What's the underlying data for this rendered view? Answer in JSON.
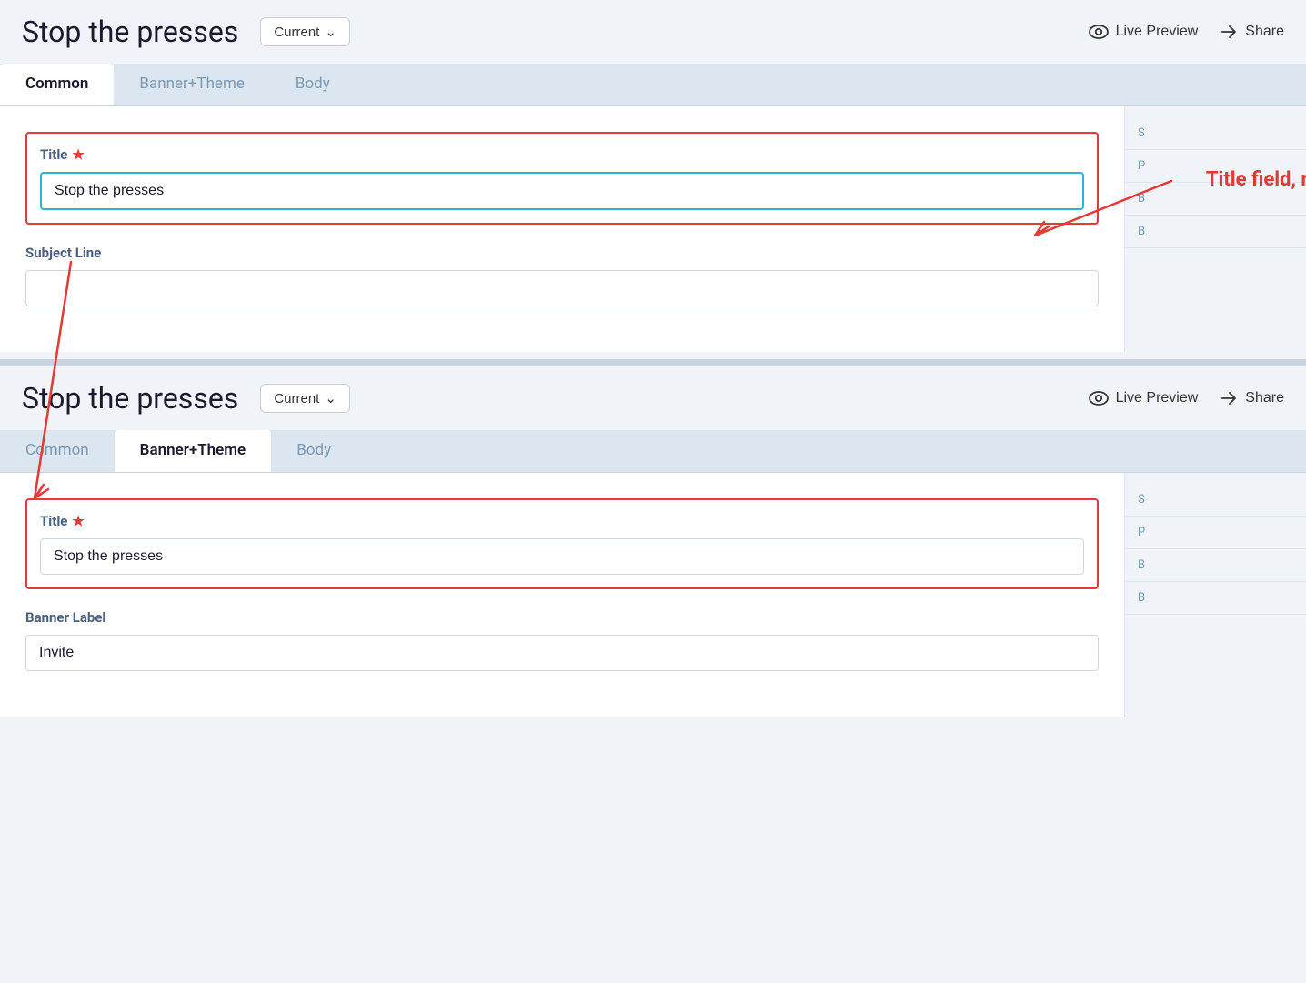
{
  "panels": [
    {
      "id": "panel-top",
      "header": {
        "title": "Stop the presses",
        "dropdown_label": "Current",
        "live_preview_label": "Live Preview",
        "share_label": "Share"
      },
      "tabs": [
        {
          "id": "common",
          "label": "Common",
          "active": true
        },
        {
          "id": "banner-theme",
          "label": "Banner+Theme",
          "active": false
        },
        {
          "id": "body",
          "label": "Body",
          "active": false
        }
      ],
      "fields": [
        {
          "id": "title",
          "label": "Title",
          "required": true,
          "value": "Stop the presses",
          "placeholder": "",
          "focused": true
        },
        {
          "id": "subject-line",
          "label": "Subject Line",
          "required": false,
          "value": "",
          "placeholder": "",
          "focused": false
        }
      ],
      "right_panel_items": [
        "S",
        "P",
        "B",
        "B"
      ]
    },
    {
      "id": "panel-bottom",
      "header": {
        "title": "Stop the presses",
        "dropdown_label": "Current",
        "live_preview_label": "Live Preview",
        "share_label": "Share"
      },
      "tabs": [
        {
          "id": "common",
          "label": "Common",
          "active": false
        },
        {
          "id": "banner-theme",
          "label": "Banner+Theme",
          "active": true
        },
        {
          "id": "body",
          "label": "Body",
          "active": false
        }
      ],
      "fields": [
        {
          "id": "title",
          "label": "Title",
          "required": true,
          "value": "Stop the presses",
          "placeholder": "",
          "focused": false
        },
        {
          "id": "banner-label",
          "label": "Banner Label",
          "required": false,
          "value": "Invite",
          "placeholder": "",
          "focused": false
        }
      ],
      "right_panel_items": [
        "S",
        "P",
        "B",
        "B"
      ]
    }
  ],
  "annotation": {
    "text": "Title field, repeated on each tab",
    "arrow_from": "annotation-text",
    "color": "#e53935"
  }
}
